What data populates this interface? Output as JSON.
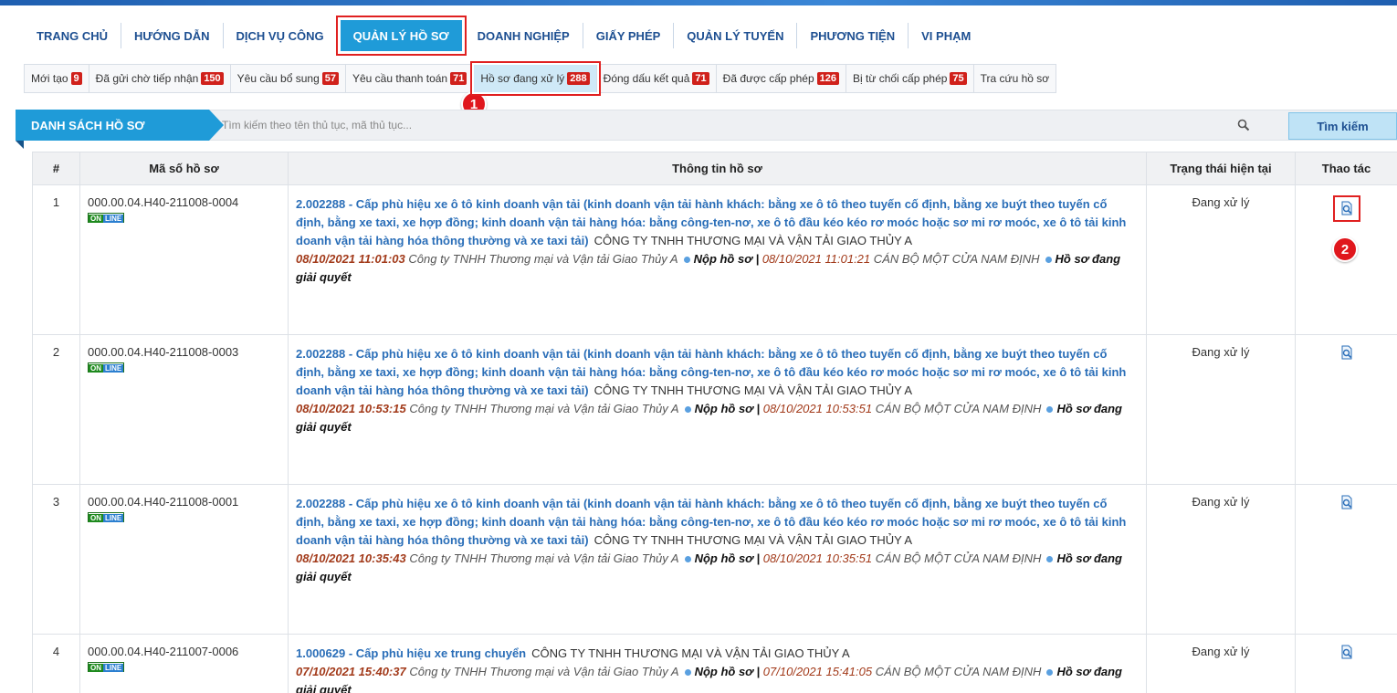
{
  "nav": {
    "items": [
      "TRANG CHỦ",
      "HƯỚNG DẪN",
      "DỊCH VỤ CÔNG",
      "QUẢN LÝ HỒ SƠ",
      "DOANH NGHIỆP",
      "GIẤY PHÉP",
      "QUẢN LÝ TUYẾN",
      "PHƯƠNG TIỆN",
      "VI PHẠM"
    ],
    "active": "QUẢN LÝ HỒ SƠ"
  },
  "tabs": [
    {
      "label": "Mới tạo",
      "count": "9"
    },
    {
      "label": "Đã gửi chờ tiếp nhận",
      "count": "150"
    },
    {
      "label": "Yêu cầu bổ sung",
      "count": "57"
    },
    {
      "label": "Yêu cầu thanh toán",
      "count": "71"
    },
    {
      "label": "Hồ sơ đang xử lý",
      "count": "288",
      "active": true
    },
    {
      "label": "Đóng dấu kết quả",
      "count": "71"
    },
    {
      "label": "Đã được cấp phép",
      "count": "126"
    },
    {
      "label": "Bị từ chối cấp phép",
      "count": "75"
    },
    {
      "label": "Tra cứu hồ sơ",
      "count": ""
    }
  ],
  "markers": {
    "one": "1",
    "two": "2"
  },
  "list": {
    "title": "DANH SÁCH HỒ SƠ",
    "search_placeholder": "Tìm kiếm theo tên thủ tục, mã thủ tục...",
    "search_button": "Tìm kiếm",
    "search_icon": "magnifier-icon"
  },
  "table": {
    "headers": {
      "num": "#",
      "code": "Mã số hồ sơ",
      "info": "Thông tin hồ sơ",
      "status": "Trạng thái hiện tại",
      "action": "Thao tác"
    },
    "online_badge": {
      "on": "ON",
      "line": "LINE"
    },
    "rows": [
      {
        "num": "1",
        "code": "000.00.04.H40-211008-0004",
        "procedure": "2.002288 - Cấp phù hiệu xe ô tô kinh doanh vận tải (kinh doanh vận tải hành khách: bằng xe ô tô theo tuyến cố định, bằng xe buýt theo tuyến cố định, bằng xe taxi, xe hợp đồng; kinh doanh vận tải hàng hóa: bằng công-ten-nơ, xe ô tô đầu kéo kéo rơ moóc hoặc sơ mi rơ moóc, xe ô tô tải kinh doanh vận tải hàng hóa thông thường và xe taxi tải)",
        "org": "CÔNG TY TNHH THƯƠNG MẠI VÀ VẬN TẢI GIAO THỦY A",
        "time1": "08/10/2021 11:01:03",
        "actor1": "Công ty TNHH Thương mại và Vận tải Giao Thủy A",
        "action1": "Nộp hồ sơ",
        "time2": "08/10/2021 11:01:21",
        "actor2": "CÁN BỘ MỘT CỬA NAM ĐỊNH",
        "action2": "Hồ sơ đang giải quyết",
        "status": "Đang xử lý"
      },
      {
        "num": "2",
        "code": "000.00.04.H40-211008-0003",
        "procedure": "2.002288 - Cấp phù hiệu xe ô tô kinh doanh vận tải (kinh doanh vận tải hành khách: bằng xe ô tô theo tuyến cố định, bằng xe buýt theo tuyến cố định, bằng xe taxi, xe hợp đồng; kinh doanh vận tải hàng hóa: bằng công-ten-nơ, xe ô tô đầu kéo kéo rơ moóc hoặc sơ mi rơ moóc, xe ô tô tải kinh doanh vận tải hàng hóa thông thường và xe taxi tải)",
        "org": "CÔNG TY TNHH THƯƠNG MẠI VÀ VẬN TẢI GIAO THỦY A",
        "time1": "08/10/2021 10:53:15",
        "actor1": "Công ty TNHH Thương mại và Vận tải Giao Thủy A",
        "action1": "Nộp hồ sơ",
        "time2": "08/10/2021 10:53:51",
        "actor2": "CÁN BỘ MỘT CỬA NAM ĐỊNH",
        "action2": "Hồ sơ đang giải quyết",
        "status": "Đang xử lý"
      },
      {
        "num": "3",
        "code": "000.00.04.H40-211008-0001",
        "procedure": "2.002288 - Cấp phù hiệu xe ô tô kinh doanh vận tải (kinh doanh vận tải hành khách: bằng xe ô tô theo tuyến cố định, bằng xe buýt theo tuyến cố định, bằng xe taxi, xe hợp đồng; kinh doanh vận tải hàng hóa: bằng công-ten-nơ, xe ô tô đầu kéo kéo rơ moóc hoặc sơ mi rơ moóc, xe ô tô tải kinh doanh vận tải hàng hóa thông thường và xe taxi tải)",
        "org": "CÔNG TY TNHH THƯƠNG MẠI VÀ VẬN TẢI GIAO THỦY A",
        "time1": "08/10/2021 10:35:43",
        "actor1": "Công ty TNHH Thương mại và Vận tải Giao Thủy A",
        "action1": "Nộp hồ sơ",
        "time2": "08/10/2021 10:35:51",
        "actor2": "CÁN BỘ MỘT CỬA NAM ĐỊNH",
        "action2": "Hồ sơ đang giải quyết",
        "status": "Đang xử lý"
      },
      {
        "num": "4",
        "code": "000.00.04.H40-211007-0006",
        "procedure": "1.000629 - Cấp phù hiệu xe trung chuyển",
        "org": "CÔNG TY TNHH THƯƠNG MẠI VÀ VẬN TẢI GIAO THỦY A",
        "time1": "07/10/2021 15:40:37",
        "actor1": "Công ty TNHH Thương mại và Vận tải Giao Thủy A",
        "action1": "Nộp hồ sơ",
        "time2": "07/10/2021 15:41:05",
        "actor2": "CÁN BỘ MỘT CỬA NAM ĐỊNH",
        "action2": "Hồ sơ đang giải quyết",
        "status": "Đang xử lý"
      }
    ]
  },
  "colors": {
    "accent": "#1f9bd8",
    "highlight": "#e02020",
    "link": "#2a6eb8",
    "count_badge": "#d0211b"
  }
}
